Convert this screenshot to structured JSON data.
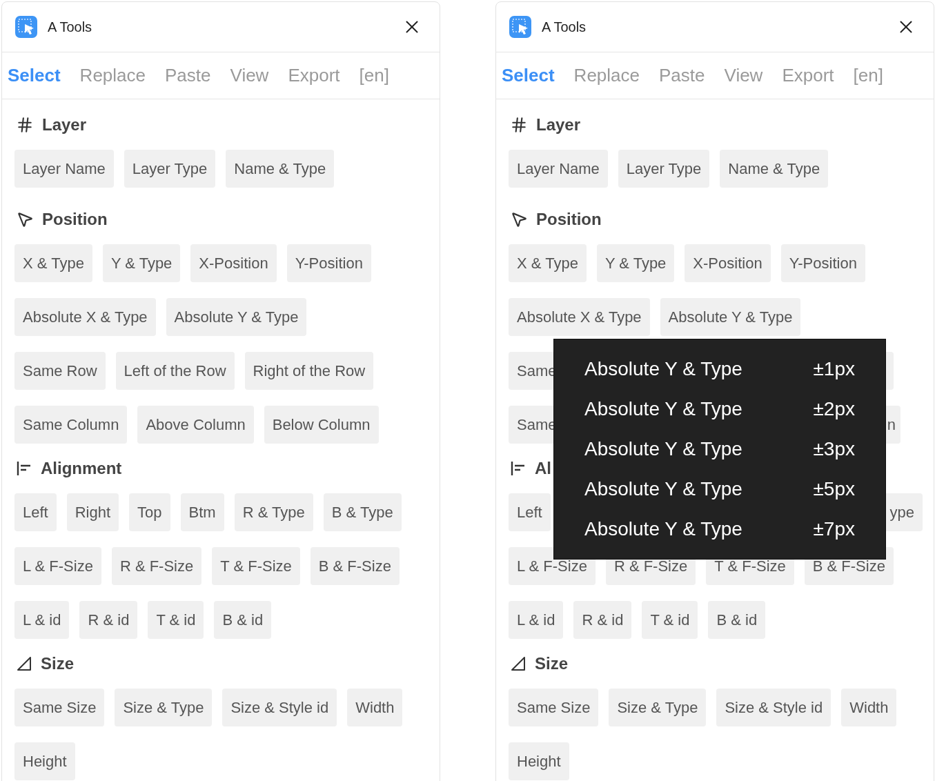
{
  "panels": [
    {
      "title": "A Tools",
      "tabs": [
        {
          "label": "Select",
          "selected": true
        },
        {
          "label": "Replace",
          "selected": false
        },
        {
          "label": "Paste",
          "selected": false
        },
        {
          "label": "View",
          "selected": false
        },
        {
          "label": "Export",
          "selected": false
        },
        {
          "label": "[en]",
          "selected": false
        }
      ],
      "sections": [
        {
          "kind": "layer",
          "title": "Layer",
          "rows": [
            {
              "buttons": [
                "Layer Name",
                "Layer Type",
                "Name & Type"
              ]
            }
          ]
        },
        {
          "kind": "position",
          "title": "Position",
          "rows": [
            {
              "buttons": [
                "X & Type",
                "Y & Type",
                "X-Position",
                "Y-Position"
              ]
            },
            {
              "buttons": [
                "Absolute X & Type",
                "Absolute Y & Type"
              ]
            },
            {
              "buttons": [
                "Same Row",
                "Left of the Row",
                "Right of the Row"
              ]
            },
            {
              "buttons": [
                "Same Column",
                "Above Column",
                "Below Column"
              ]
            }
          ]
        },
        {
          "kind": "alignment",
          "title": "Alignment",
          "rows": [
            {
              "buttons": [
                "Left",
                "Right",
                "Top",
                "Btm",
                "R & Type",
                "B & Type"
              ]
            },
            {
              "buttons": [
                "L & F-Size",
                "R & F-Size",
                "T & F-Size",
                "B & F-Size"
              ]
            },
            {
              "buttons": [
                "L & id",
                "R & id",
                "T & id",
                "B & id"
              ]
            }
          ]
        },
        {
          "kind": "size",
          "title": "Size",
          "rows": [
            {
              "buttons": [
                "Same Size",
                "Size & Type",
                "Size & Style id",
                "Width"
              ]
            },
            {
              "buttons": [
                "Height"
              ]
            }
          ]
        }
      ]
    },
    {
      "title": "A Tools",
      "tabs": [
        {
          "label": "Select",
          "selected": true
        },
        {
          "label": "Replace",
          "selected": false
        },
        {
          "label": "Paste",
          "selected": false
        },
        {
          "label": "View",
          "selected": false
        },
        {
          "label": "Export",
          "selected": false
        },
        {
          "label": "[en]",
          "selected": false
        }
      ],
      "sections": [
        {
          "kind": "layer",
          "title": "Layer",
          "rows": [
            {
              "buttons": [
                "Layer Name",
                "Layer Type",
                "Name & Type"
              ]
            }
          ]
        },
        {
          "kind": "position",
          "title": "Position",
          "rows": [
            {
              "buttons": [
                "X & Type",
                "Y & Type",
                "X-Position",
                "Y-Position"
              ]
            },
            {
              "buttons": [
                "Absolute X & Type",
                "Absolute Y & Type"
              ]
            },
            {
              "buttons": [
                {
                  "kind": "cut_left",
                  "label": "Same"
                },
                {
                  "kind": "stub"
                }
              ]
            },
            {
              "buttons": [
                {
                  "kind": "cut_left",
                  "label": "Same"
                },
                {
                  "kind": "cut_mid",
                  "label": "n"
                }
              ]
            }
          ]
        },
        {
          "kind": "alignment",
          "title": "Al",
          "rows": [
            {
              "buttons": [
                "Left",
                {
                  "kind": "cut_right",
                  "label": "ype"
                }
              ]
            },
            {
              "buttons": [
                "L & F-Size",
                "R & F-Size",
                "T & F-Size",
                "B & F-Size"
              ]
            },
            {
              "buttons": [
                "L & id",
                "R & id",
                "T & id",
                "B & id"
              ]
            }
          ]
        },
        {
          "kind": "size",
          "title": "Size",
          "rows": [
            {
              "buttons": [
                "Same Size",
                "Size & Type",
                "Size & Style id",
                "Width"
              ]
            },
            {
              "buttons": [
                "Height"
              ]
            }
          ]
        }
      ],
      "menu": [
        {
          "label": "Absolute Y & Type",
          "value": "±1px"
        },
        {
          "label": "Absolute Y & Type",
          "value": "±2px"
        },
        {
          "label": "Absolute Y & Type",
          "value": "±3px"
        },
        {
          "label": "Absolute Y & Type",
          "value": "±5px"
        },
        {
          "label": "Absolute Y & Type",
          "value": "±7px"
        }
      ]
    }
  ]
}
